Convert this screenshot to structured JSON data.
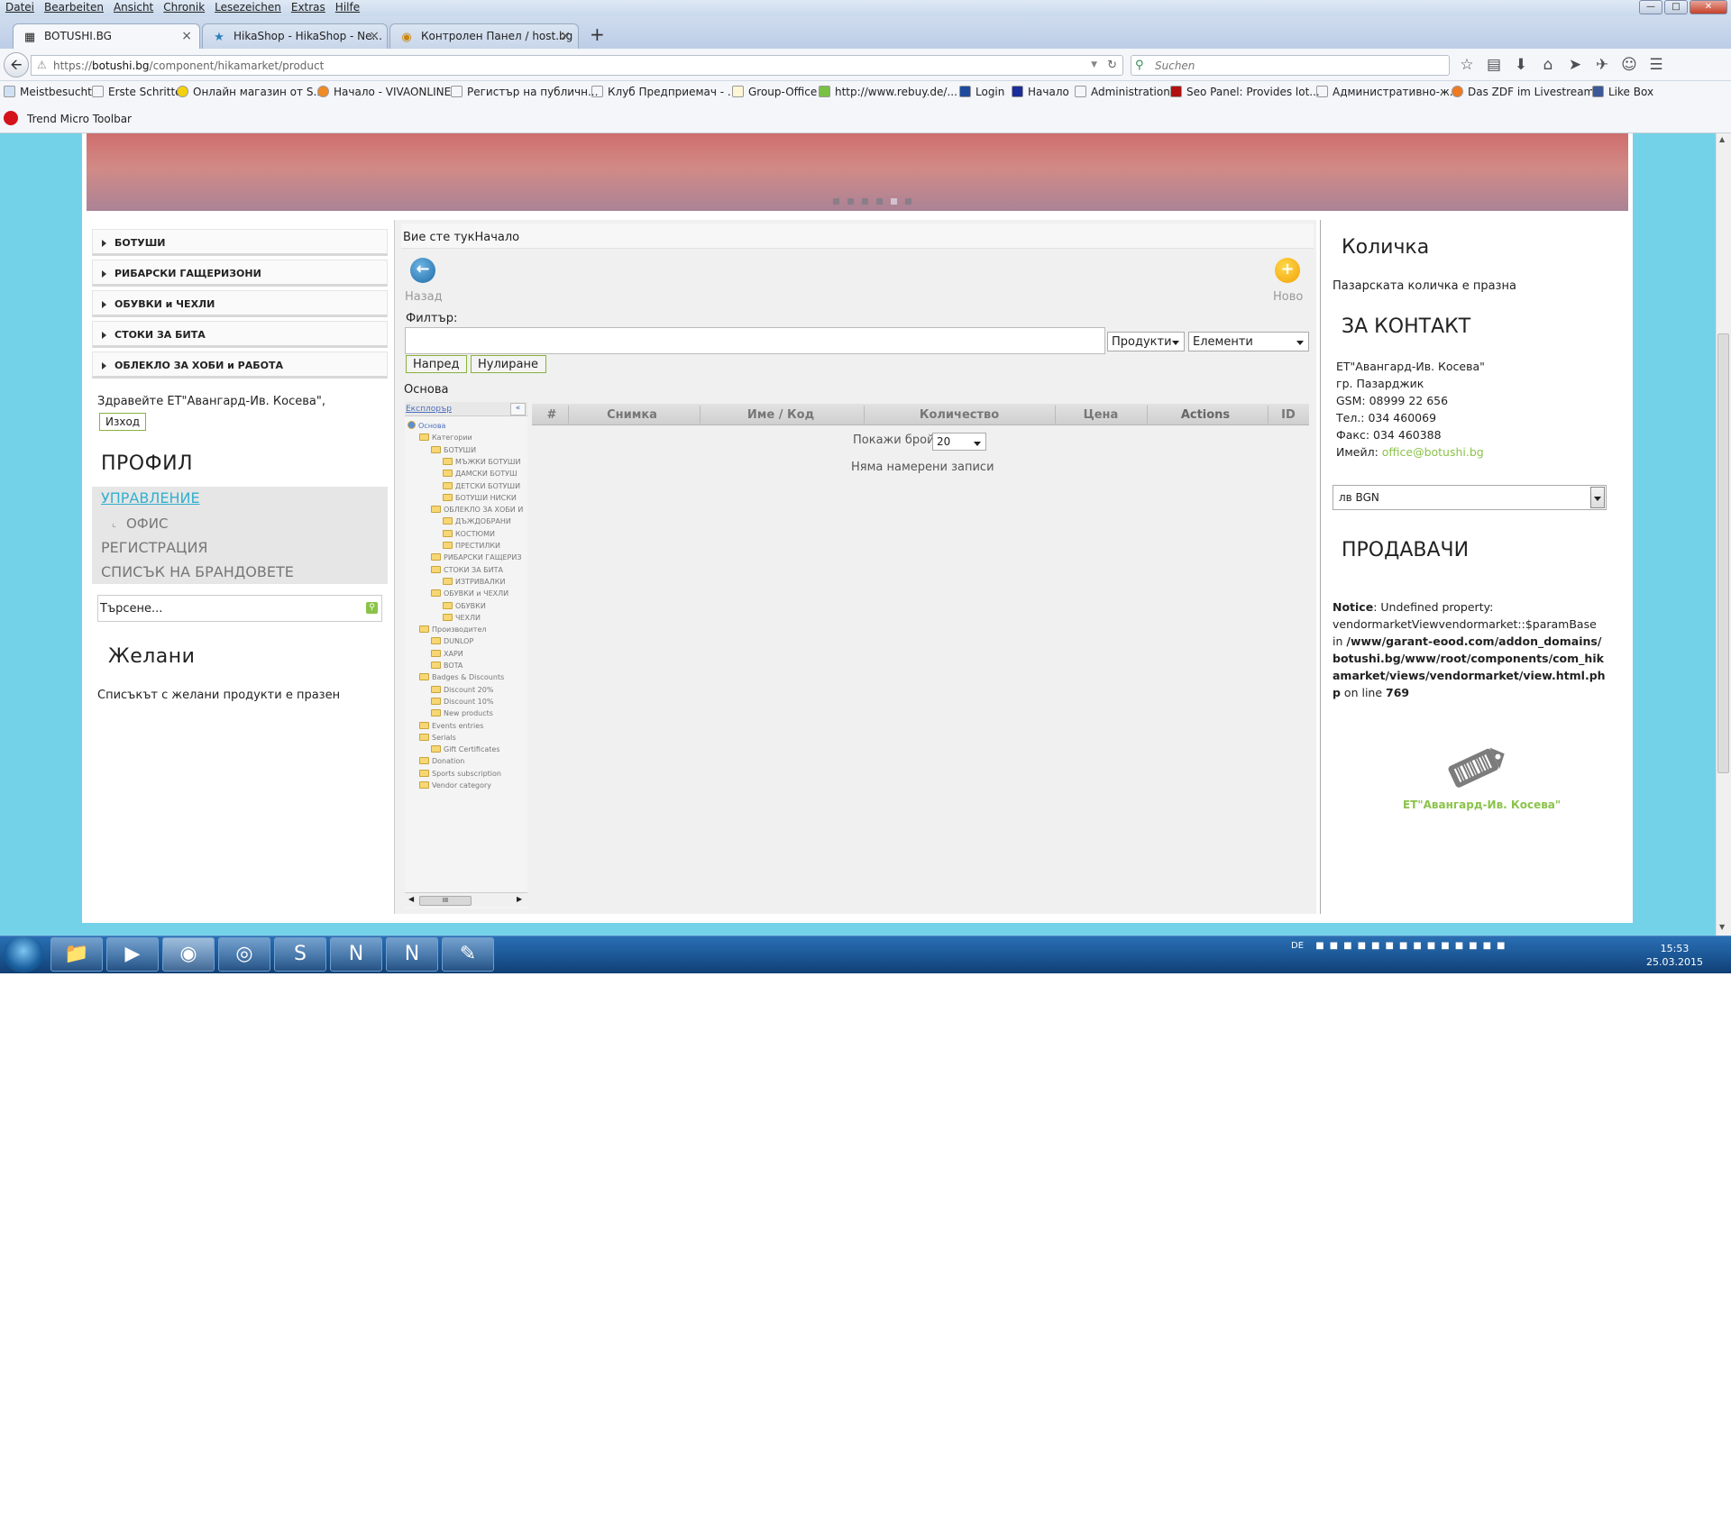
{
  "menubar": {
    "items": [
      "Datei",
      "Bearbeiten",
      "Ansicht",
      "Chronik",
      "Lesezeichen",
      "Extras",
      "Hilfe"
    ]
  },
  "tabs": [
    {
      "label": "BOTUSHI.BG",
      "icon": "grid-icon"
    },
    {
      "label": "HikaShop - HikaShop - Ne...",
      "icon": "hikashop-icon"
    },
    {
      "label": "Контролен Панел / host.bg",
      "icon": "hostbg-icon"
    }
  ],
  "nav": {
    "url_prefix": "https://",
    "url_domain": "botushi.bg",
    "url_path": "/component/hikamarket/product",
    "search_placeholder": "Suchen"
  },
  "bookmarks": [
    "Meistbesucht",
    "Erste Schritte",
    "Онлайн магазин от S...",
    "Начало - VIVAONLINE",
    "Регистър на публичн...",
    "Клуб Предприемач - ...",
    "Group-Office",
    "http://www.rebuy.de/...",
    "Login",
    "Начало",
    "Administration",
    "Seo Panel: Provides lot...",
    "Административно-ж...",
    "Das ZDF im Livestream...",
    "Like Box"
  ],
  "toolbar2": {
    "label": "Trend Micro Toolbar"
  },
  "left": {
    "menu": [
      "БОТУШИ",
      "РИБАРСКИ ГАЩЕРИЗОНИ",
      "ОБУВКИ и ЧЕХЛИ",
      "СТОКИ ЗА БИТА",
      "ОБЛЕКЛО ЗА ХОБИ и РАБОТА"
    ],
    "greeting": "Здравейте ЕТ\"Авангард-Ив. Косева\",",
    "logout": "Изход",
    "profile_title": "ПРОФИЛ",
    "manage": "УПРАВЛЕНИЕ",
    "office": "ОФИС",
    "register": "РЕГИСТРАЦИЯ",
    "brands": "СПИСЪК НА БРАНДОВЕТЕ",
    "search_placeholder": "Търсене...",
    "wish_title": "Желани",
    "wish_text": "Списъкът с желани продукти е празен"
  },
  "center": {
    "breadcrumb": "Вие сте тукНачало",
    "back_label": "Назад",
    "new_label": "Ново",
    "filter_label": "Филтър:",
    "select_products": "Продукти",
    "select_elements": "Елементи",
    "go_button": "Напред",
    "reset_button": "Нулиране",
    "section": "Основа",
    "tree_header": "Експлорър",
    "tree": [
      "Основа",
      "Категории",
      "БОТУШИ",
      "МЪЖКИ БОТУШИ",
      "ДАМСКИ БОТУШ",
      "ДЕТСКИ БОТУШИ",
      "БОТУШИ НИСКИ",
      "ОБЛЕКЛО ЗА ХОБИ И",
      "ДЪЖДОБРАНИ",
      "КОСТЮМИ",
      "ПРЕСТИЛКИ",
      "РИБАРСКИ ГАЩЕРИЗ",
      "СТОКИ ЗА БИТА",
      "ИЗТРИВАЛКИ",
      "ОБУВКИ и ЧЕХЛИ",
      "ОБУВКИ",
      "ЧЕХЛИ",
      "Производител",
      "DUNLOP",
      "ХАРИ",
      "BOTA",
      "Badges & Discounts",
      "Discount 20%",
      "Discount 10%",
      "New products",
      "Events entries",
      "Serials",
      "Gift Certificates",
      "Donation",
      "Sports subscription",
      "Vendor category"
    ],
    "tree_scroll": "III",
    "columns": [
      "#",
      "Снимка",
      "Име / Код",
      "Количество",
      "Цена",
      "Actions",
      "ID"
    ],
    "show_count_label": "Покажи брой",
    "show_count_value": "20",
    "no_records": "Няма намерени записи"
  },
  "right": {
    "cart_title": "Количка",
    "cart_text": "Пазарската количка е празна",
    "contact_title": "ЗА КОНТАКТ",
    "contact_lines": [
      "ЕТ\"Авангард-Ив. Косева\"",
      "гр. Пазарджик",
      "GSM: 08999 22 656",
      "Тел.: 034 460069",
      "Факс: 034 460388"
    ],
    "email_label": "Имейл:",
    "email": "office@botushi.bg",
    "currency": "лв BGN",
    "vendors_title": "ПРОДАВАЧИ",
    "notice_label": "Notice",
    "notice_text": ": Undefined property: vendormarketViewvendormarket::$paramBase in",
    "notice_path": "/www/garant-eood.com/addon_domains/botushi.bg/www/root/components/com_hikamarket/views/vendormarket/view.html.php",
    "notice_online": " on line ",
    "notice_line": "769",
    "vendor_name": "ЕТ\"Авангард-Ив. Косева\""
  },
  "taskbar": {
    "lang": "DE",
    "time": "15:53",
    "date": "25.03.2015"
  },
  "colors": {
    "accent_green": "#8bc34a",
    "link_blue": "#33b0cf",
    "page_bg": "#74d2e8"
  }
}
